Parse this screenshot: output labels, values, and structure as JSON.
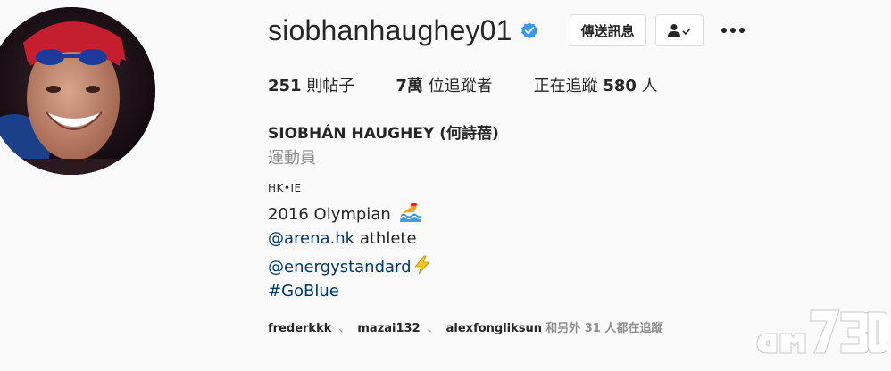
{
  "profile": {
    "username": "siobhanhaughey01",
    "message_button": "傳送訊息",
    "posts_count": "251",
    "posts_label": "則帖子",
    "followers_count": "7萬",
    "followers_label": "位追蹤者",
    "following_prefix": "正在追蹤",
    "following_count": "580",
    "following_suffix": "人",
    "full_name": "SIOBHÁN HAUGHEY (何詩蓓)",
    "category": "運動員"
  },
  "bio": {
    "line1": "HK•IE",
    "line2": "2016 Olympian",
    "line3_link": "@arena.hk",
    "line3_text": " athlete",
    "line4_link": "@energystandard",
    "line5_link": "#GoBlue"
  },
  "followed_by": {
    "names": [
      "frederkkk",
      "mazai132",
      "alexfongliksun"
    ],
    "separator": "、",
    "suffix": "和另外 31 人都在追蹤"
  },
  "icons": {
    "verified": "verified-badge-icon",
    "follow": "person-check-icon",
    "more": "more-dots-icon",
    "swimmer": "swimmer-emoji-icon",
    "lightning": "lightning-emoji-icon"
  },
  "colors": {
    "link": "#00376b",
    "verified": "#3897f0",
    "secondary_text": "#8e8e8e"
  }
}
